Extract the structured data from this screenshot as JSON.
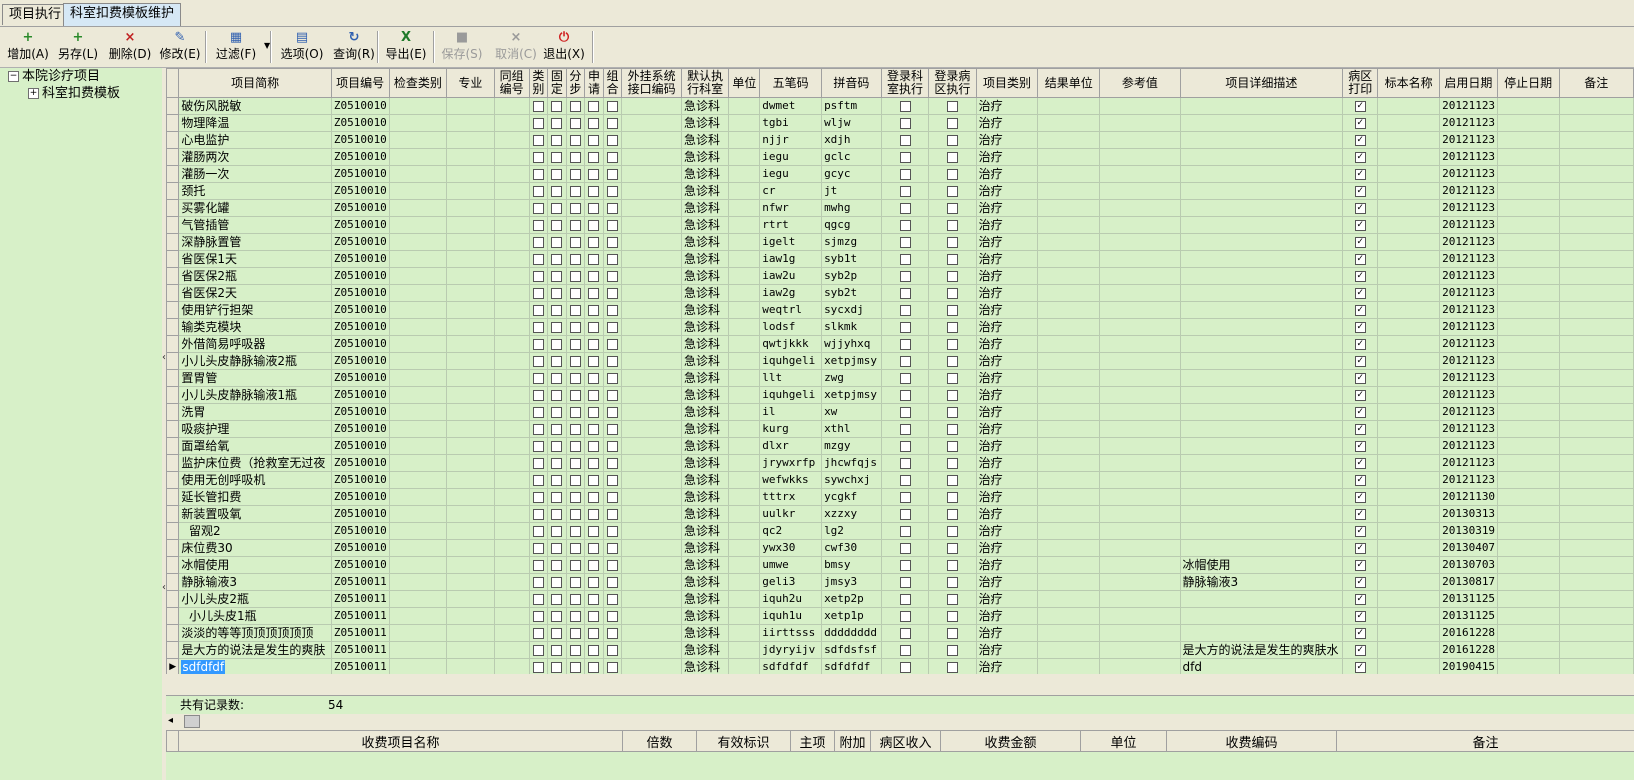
{
  "tabs": [
    "项目执行",
    "科室扣费模板维护"
  ],
  "toolbar": [
    {
      "label": "增加(A)",
      "icon": "add-icon",
      "glyph": "+",
      "color": "#2a8a2a",
      "enabled": true
    },
    {
      "label": "另存(L)",
      "icon": "save-as-icon",
      "glyph": "+",
      "color": "#2a8a2a",
      "enabled": true
    },
    {
      "label": "删除(D)",
      "icon": "delete-icon",
      "glyph": "×",
      "color": "#c02020",
      "enabled": true
    },
    {
      "label": "修改(E)",
      "icon": "edit-icon",
      "glyph": "✎",
      "color": "#3060b0",
      "enabled": true
    },
    {
      "label": "过滤(F)",
      "icon": "filter-icon",
      "glyph": "▦",
      "color": "#3060b0",
      "enabled": true
    },
    {
      "label": "选项(O)",
      "icon": "options-icon",
      "glyph": "▤",
      "color": "#3060b0",
      "enabled": true
    },
    {
      "label": "查询(R)",
      "icon": "query-icon",
      "glyph": "↻",
      "color": "#3060b0",
      "enabled": true
    },
    {
      "label": "导出(E)",
      "icon": "excel-export-icon",
      "glyph": "X",
      "color": "#1f7a2a",
      "enabled": true
    },
    {
      "label": "保存(S)",
      "icon": "save-icon",
      "glyph": "■",
      "color": "#9a9a9a",
      "enabled": false
    },
    {
      "label": "取消(C)",
      "icon": "cancel-icon",
      "glyph": "×",
      "color": "#9a9a9a",
      "enabled": false
    },
    {
      "label": "退出(X)",
      "icon": "exit-icon",
      "glyph": "⏻",
      "color": "#d02020",
      "enabled": true
    }
  ],
  "tree": {
    "root": "本院诊疗项目",
    "child": "科室扣费模板"
  },
  "columns": [
    "项目简称",
    "项目编号",
    "检查类别",
    "专业",
    "同组编号",
    "类别",
    "固定",
    "分步",
    "申请",
    "组合",
    "外挂系统接口编码",
    "默认执行科室",
    "单位",
    "五笔码",
    "拼音码",
    "登录科室执行",
    "登录病区执行",
    "项目类别",
    "结果单位",
    "参考值",
    "项目详细描述",
    "病区打印",
    "标本名称",
    "启用日期",
    "停止日期",
    "备注"
  ],
  "rows": [
    {
      "name": "破伤风脱敏",
      "code": "Z0510010",
      "dept": "急诊科",
      "wubi": "dwmet",
      "pinyin": "psftm",
      "type": "治疗",
      "desc": "",
      "date": "20121123"
    },
    {
      "name": "物理降温",
      "code": "Z0510010",
      "dept": "急诊科",
      "wubi": "tgbi",
      "pinyin": "wljw",
      "type": "治疗",
      "desc": "",
      "date": "20121123"
    },
    {
      "name": "心电监护",
      "code": "Z0510010",
      "dept": "急诊科",
      "wubi": "njjr",
      "pinyin": "xdjh",
      "type": "治疗",
      "desc": "",
      "date": "20121123"
    },
    {
      "name": "灌肠两次",
      "code": "Z0510010",
      "dept": "急诊科",
      "wubi": "iegu",
      "pinyin": "gclc",
      "type": "治疗",
      "desc": "",
      "date": "20121123"
    },
    {
      "name": "灌肠一次",
      "code": "Z0510010",
      "dept": "急诊科",
      "wubi": "iegu",
      "pinyin": "gcyc",
      "type": "治疗",
      "desc": "",
      "date": "20121123"
    },
    {
      "name": "颈托",
      "code": "Z0510010",
      "dept": "急诊科",
      "wubi": "cr",
      "pinyin": "jt",
      "type": "治疗",
      "desc": "",
      "date": "20121123"
    },
    {
      "name": "买雾化罐",
      "code": "Z0510010",
      "dept": "急诊科",
      "wubi": "nfwr",
      "pinyin": "mwhg",
      "type": "治疗",
      "desc": "",
      "date": "20121123"
    },
    {
      "name": "气管插管",
      "code": "Z0510010",
      "dept": "急诊科",
      "wubi": "rtrt",
      "pinyin": "qgcg",
      "type": "治疗",
      "desc": "",
      "date": "20121123"
    },
    {
      "name": "深静脉置管",
      "code": "Z0510010",
      "dept": "急诊科",
      "wubi": "igelt",
      "pinyin": "sjmzg",
      "type": "治疗",
      "desc": "",
      "date": "20121123"
    },
    {
      "name": "省医保1天",
      "code": "Z0510010",
      "dept": "急诊科",
      "wubi": "iaw1g",
      "pinyin": "syb1t",
      "type": "治疗",
      "desc": "",
      "date": "20121123"
    },
    {
      "name": "省医保2瓶",
      "code": "Z0510010",
      "dept": "急诊科",
      "wubi": "iaw2u",
      "pinyin": "syb2p",
      "type": "治疗",
      "desc": "",
      "date": "20121123"
    },
    {
      "name": "省医保2天",
      "code": "Z0510010",
      "dept": "急诊科",
      "wubi": "iaw2g",
      "pinyin": "syb2t",
      "type": "治疗",
      "desc": "",
      "date": "20121123"
    },
    {
      "name": "使用铲行担架",
      "code": "Z0510010",
      "dept": "急诊科",
      "wubi": "weqtrl",
      "pinyin": "sycxdj",
      "type": "治疗",
      "desc": "",
      "date": "20121123"
    },
    {
      "name": "输类克模块",
      "code": "Z0510010",
      "dept": "急诊科",
      "wubi": "lodsf",
      "pinyin": "slkmk",
      "type": "治疗",
      "desc": "",
      "date": "20121123"
    },
    {
      "name": "外借简易呼吸器",
      "code": "Z0510010",
      "dept": "急诊科",
      "wubi": "qwtjkkk",
      "pinyin": "wjjyhxq",
      "type": "治疗",
      "desc": "",
      "date": "20121123"
    },
    {
      "name": "小儿头皮静脉输液2瓶",
      "code": "Z0510010",
      "dept": "急诊科",
      "wubi": "iquhgeli",
      "pinyin": "xetpjmsy",
      "type": "治疗",
      "desc": "",
      "date": "20121123"
    },
    {
      "name": "置胃管",
      "code": "Z0510010",
      "dept": "急诊科",
      "wubi": "llt",
      "pinyin": "zwg",
      "type": "治疗",
      "desc": "",
      "date": "20121123"
    },
    {
      "name": "小儿头皮静脉输液1瓶",
      "code": "Z0510010",
      "dept": "急诊科",
      "wubi": "iquhgeli",
      "pinyin": "xetpjmsy",
      "type": "治疗",
      "desc": "",
      "date": "20121123"
    },
    {
      "name": "洗胃",
      "code": "Z0510010",
      "dept": "急诊科",
      "wubi": "il",
      "pinyin": "xw",
      "type": "治疗",
      "desc": "",
      "date": "20121123"
    },
    {
      "name": "吸痰护理",
      "code": "Z0510010",
      "dept": "急诊科",
      "wubi": "kurg",
      "pinyin": "xthl",
      "type": "治疗",
      "desc": "",
      "date": "20121123"
    },
    {
      "name": "面罩给氧",
      "code": "Z0510010",
      "dept": "急诊科",
      "wubi": "dlxr",
      "pinyin": "mzgy",
      "type": "治疗",
      "desc": "",
      "date": "20121123"
    },
    {
      "name": "监护床位费（抢救室无过夜",
      "code": "Z0510010",
      "dept": "急诊科",
      "wubi": "jrywxrfp",
      "pinyin": "jhcwfqjs",
      "type": "治疗",
      "desc": "",
      "date": "20121123"
    },
    {
      "name": "使用无创呼吸机",
      "code": "Z0510010",
      "dept": "急诊科",
      "wubi": "wefwkks",
      "pinyin": "sywchxj",
      "type": "治疗",
      "desc": "",
      "date": "20121123"
    },
    {
      "name": "延长管扣费",
      "code": "Z0510010",
      "dept": "急诊科",
      "wubi": "tttrx",
      "pinyin": "ycgkf",
      "type": "治疗",
      "desc": "",
      "date": "20121130"
    },
    {
      "name": "新装置吸氧",
      "code": "Z0510010",
      "dept": "急诊科",
      "wubi": "uulkr",
      "pinyin": "xzzxy",
      "type": "治疗",
      "desc": "",
      "date": "20130313"
    },
    {
      "name": "  留观2",
      "code": "Z0510010",
      "dept": "急诊科",
      "wubi": "qc2",
      "pinyin": "lg2",
      "type": "治疗",
      "desc": "",
      "date": "20130319"
    },
    {
      "name": "床位费30",
      "code": "Z0510010",
      "dept": "急诊科",
      "wubi": "ywx30",
      "pinyin": "cwf30",
      "type": "治疗",
      "desc": "",
      "date": "20130407"
    },
    {
      "name": "冰帽使用",
      "code": "Z0510010",
      "dept": "急诊科",
      "wubi": "umwe",
      "pinyin": "bmsy",
      "type": "治疗",
      "desc": "冰帽使用",
      "date": "20130703"
    },
    {
      "name": "静脉输液3",
      "code": "Z0510011",
      "dept": "急诊科",
      "wubi": "geli3",
      "pinyin": "jmsy3",
      "type": "治疗",
      "desc": "静脉输液3",
      "date": "20130817"
    },
    {
      "name": "小儿头皮2瓶",
      "code": "Z0510011",
      "dept": "急诊科",
      "wubi": "iquh2u",
      "pinyin": "xetp2p",
      "type": "治疗",
      "desc": "",
      "date": "20131125"
    },
    {
      "name": "  小儿头皮1瓶",
      "code": "Z0510011",
      "dept": "急诊科",
      "wubi": "iquh1u",
      "pinyin": "xetp1p",
      "type": "治疗",
      "desc": "",
      "date": "20131125"
    },
    {
      "name": "淡淡的等等顶顶顶顶顶顶",
      "code": "Z0510011",
      "dept": "急诊科",
      "wubi": "iirttsss",
      "pinyin": "dddddddd",
      "type": "治疗",
      "desc": "",
      "date": "20161228"
    },
    {
      "name": "是大方的说法是发生的爽肤",
      "code": "Z0510011",
      "dept": "急诊科",
      "wubi": "jdyryijv",
      "pinyin": "sdfdsfsf",
      "type": "治疗",
      "desc": "是大方的说法是发生的爽肤水",
      "date": "20161228"
    },
    {
      "name": "sdfdfdf",
      "code": "Z0510011",
      "dept": "急诊科",
      "wubi": "sdfdfdf",
      "pinyin": "sdfdfdf",
      "type": "治疗",
      "desc": "dfd",
      "date": "20190415",
      "selected": true
    }
  ],
  "footer": {
    "label": "共有记录数:",
    "count": "54"
  },
  "bottom_columns": [
    "收费项目名称",
    "倍数",
    "有效标识",
    "主项",
    "附加",
    "病区收入",
    "收费金额",
    "单位",
    "收费编码",
    "备注"
  ],
  "colors": {
    "grid_bg": "#d7f0c8",
    "toolbar_bg": "#ece9d8",
    "selection": "#3399ff"
  }
}
